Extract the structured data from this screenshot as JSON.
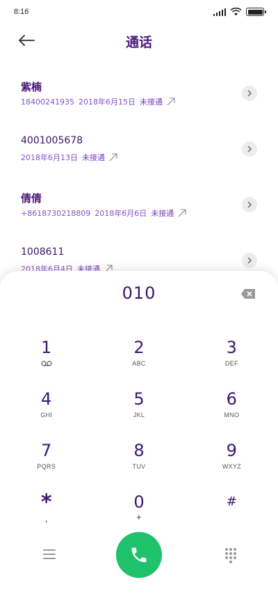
{
  "status_bar": {
    "time": "8:16"
  },
  "header": {
    "title": "通话"
  },
  "calls": [
    {
      "name": "紫楠",
      "number": "18400241935",
      "date": "2018年6月15日",
      "status": "未接通"
    },
    {
      "name": "4001005678",
      "number": "",
      "date": "2018年6月13日",
      "status": "未接通"
    },
    {
      "name": "倩倩",
      "number": "+8618730218809",
      "date": "2018年6月6日",
      "status": "未接通"
    },
    {
      "name": "1008611",
      "number": "",
      "date": "2018年6月4日",
      "status": "未接通"
    }
  ],
  "dialer": {
    "input_value": "010",
    "keys": [
      {
        "digit": "1",
        "letters": ""
      },
      {
        "digit": "2",
        "letters": "ABC"
      },
      {
        "digit": "3",
        "letters": "DEF"
      },
      {
        "digit": "4",
        "letters": "GHI"
      },
      {
        "digit": "5",
        "letters": "JKL"
      },
      {
        "digit": "6",
        "letters": "MNO"
      },
      {
        "digit": "7",
        "letters": "PQRS"
      },
      {
        "digit": "8",
        "letters": "TUV"
      },
      {
        "digit": "9",
        "letters": "WXYZ"
      },
      {
        "digit": "*",
        "letters": ","
      },
      {
        "digit": "0",
        "letters": "+"
      },
      {
        "digit": "#",
        "letters": ""
      }
    ]
  },
  "icons": {
    "back": "arrow-left-icon",
    "detail": "chevron-right-icon",
    "outgoing": "arrow-up-right-icon",
    "backspace": "backspace-icon",
    "voicemail": "voicemail-icon",
    "menu": "menu-icon",
    "call": "phone-icon",
    "dialpad": "dialpad-icon"
  },
  "colors": {
    "accent": "#1fc16a",
    "text": "#4a1578",
    "meta": "#8a52c8"
  }
}
